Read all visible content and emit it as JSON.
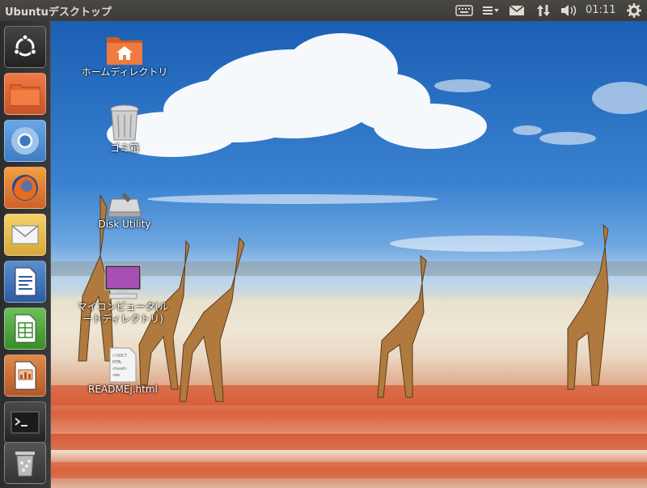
{
  "panel": {
    "title": "Ubuntuデスクトップ",
    "clock": "01:11"
  },
  "indicators": [
    "keyboard-icon",
    "menu-icon",
    "mail-icon",
    "network-icon",
    "volume-icon",
    "gear-icon"
  ],
  "launcher": {
    "items": [
      {
        "name": "dash-home",
        "icon": "ubuntu-logo-icon"
      },
      {
        "name": "files",
        "icon": "folder-icon"
      },
      {
        "name": "chromium",
        "icon": "chromium-icon"
      },
      {
        "name": "firefox",
        "icon": "firefox-icon"
      },
      {
        "name": "mail",
        "icon": "mail-icon"
      },
      {
        "name": "writer",
        "icon": "writer-icon"
      },
      {
        "name": "calc",
        "icon": "calc-icon"
      },
      {
        "name": "impress",
        "icon": "impress-icon"
      },
      {
        "name": "terminal",
        "icon": "terminal-icon"
      },
      {
        "name": "trash",
        "icon": "trash-icon"
      }
    ]
  },
  "desktop": {
    "icons": [
      {
        "label": "ホームディレクトリ"
      },
      {
        "label": "ゴミ箱"
      },
      {
        "label": "Disk Utility"
      },
      {
        "label_line1": "マイコンピュータ(ル",
        "label_line2": "ートディレクトリ)"
      },
      {
        "label": "READMEj.html",
        "doc_text": "<!DOCT\nHTML\n<head>\n<me"
      }
    ]
  },
  "colors": {
    "panel_bg": "#3c3b37",
    "launcher_bg": "#2b2d2f",
    "folder_orange": "#e2622a",
    "sky_blue": "#2f74c6"
  }
}
